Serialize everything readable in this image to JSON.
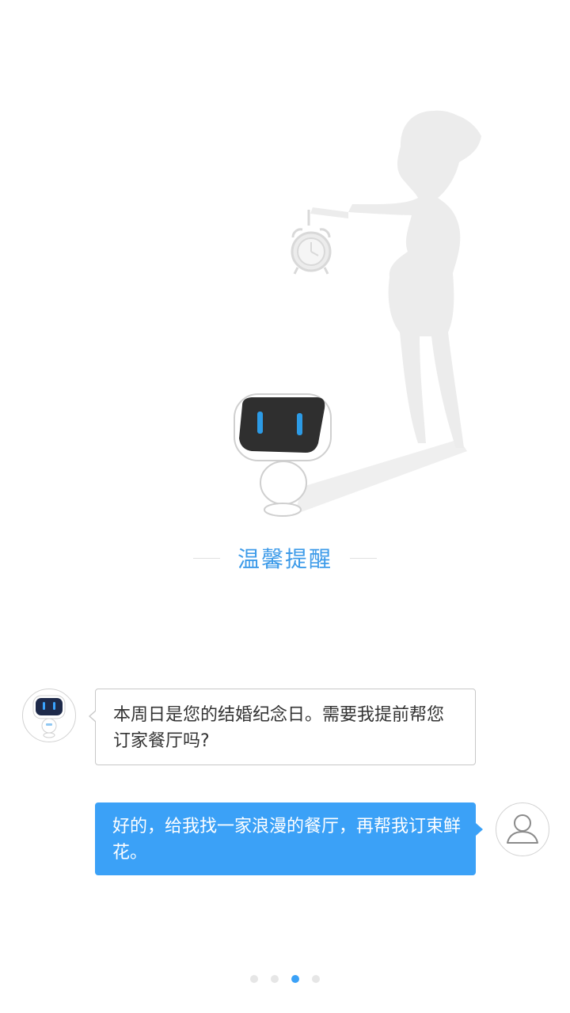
{
  "title": "温馨提醒",
  "chat": {
    "robot_message": "本周日是您的结婚纪念日。需要我提前帮您订家餐厅吗?",
    "user_message": "好的，给我找一家浪漫的餐厅，再帮我订束鲜花。"
  },
  "pager": {
    "total": 4,
    "active_index": 2
  },
  "icons": {
    "robot_avatar": "robot-icon",
    "user_avatar": "user-icon",
    "alarm_clock": "alarm-clock-icon"
  },
  "colors": {
    "accent": "#3ba1f7",
    "title": "#3d9be9",
    "silhouette": "#ececec",
    "robot_face": "#2f2f2f",
    "robot_eyes": "#2c9be6",
    "dot_inactive": "#e6e6e6"
  }
}
